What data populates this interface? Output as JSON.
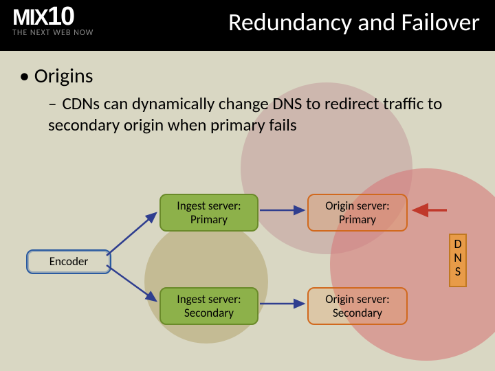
{
  "logo": {
    "line1_a": "MIX",
    "line1_b": "10",
    "tagline": "THE NEXT WEB NOW"
  },
  "title": "Redundancy and Failover",
  "bullets": {
    "l1": "Origins",
    "l2": "CDNs can dynamically change DNS to redirect traffic to secondary origin when primary fails"
  },
  "diagram": {
    "encoder": "Encoder",
    "ingest_primary": {
      "a": "Ingest server:",
      "b": "Primary"
    },
    "ingest_secondary": {
      "a": "Ingest server:",
      "b": "Secondary"
    },
    "origin_primary": {
      "a": "Origin server:",
      "b": "Primary"
    },
    "origin_secondary": {
      "a": "Origin server:",
      "b": "Secondary"
    },
    "dns": {
      "a": "D",
      "b": "N",
      "c": "S"
    }
  }
}
